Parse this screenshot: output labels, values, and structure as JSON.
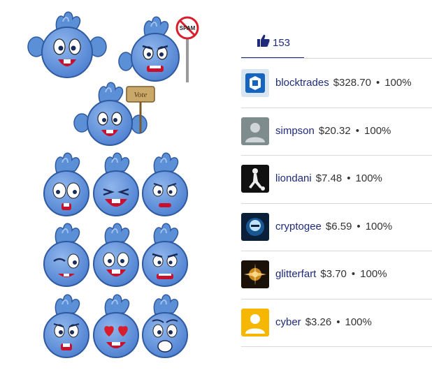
{
  "votes": {
    "count": "153",
    "icon": "thumbs-up-icon",
    "accent": "#1f2b7a"
  },
  "signs": {
    "spam": "SPAM",
    "vote": "Vote"
  },
  "voters": [
    {
      "user": "blocktrades",
      "amount": "$328.70",
      "sep": "•",
      "percent": "100%"
    },
    {
      "user": "simpson",
      "amount": "$20.32",
      "sep": "•",
      "percent": "100%"
    },
    {
      "user": "liondani",
      "amount": "$7.48",
      "sep": "•",
      "percent": "100%"
    },
    {
      "user": "cryptogee",
      "amount": "$6.59",
      "sep": "•",
      "percent": "100%"
    },
    {
      "user": "glitterfart",
      "amount": "$3.70",
      "sep": "•",
      "percent": "100%"
    },
    {
      "user": "cyber",
      "amount": "$3.26",
      "sep": "•",
      "percent": "100%"
    }
  ]
}
